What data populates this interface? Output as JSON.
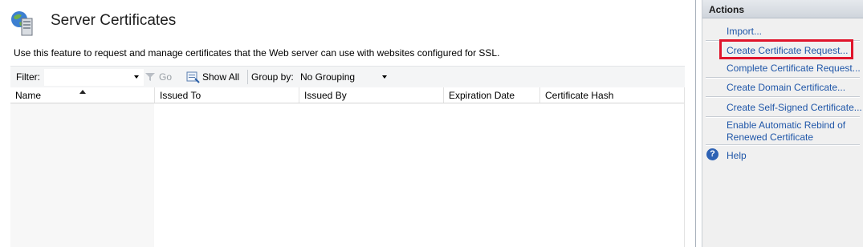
{
  "header": {
    "title": "Server Certificates",
    "description": "Use this feature to request and manage certificates that the Web server can use with websites configured for SSL."
  },
  "toolbar": {
    "filter_label": "Filter:",
    "filter_value": "",
    "go_label": "Go",
    "show_all_label": "Show All",
    "group_by_label": "Group by:",
    "group_by_value": "No Grouping"
  },
  "grid": {
    "columns": [
      "Name",
      "Issued To",
      "Issued By",
      "Expiration Date",
      "Certificate Hash"
    ],
    "sorted_column": "Name",
    "sort_direction": "ascending",
    "rows": []
  },
  "actions": {
    "title": "Actions",
    "items": [
      "Import...",
      "Create Certificate Request...",
      "Complete Certificate Request...",
      "Create Domain Certificate...",
      "Create Self-Signed Certificate...",
      "Enable Automatic Rebind of",
      "Renewed Certificate",
      "Help"
    ],
    "highlighted_item": "Create Certificate Request..."
  },
  "colors": {
    "link": "#1f56a8",
    "highlight": "#e0142b",
    "panel_bg": "#f0f0f0"
  },
  "icons": [
    "server-globe-icon",
    "filter-funnel-icon",
    "show-all-icon",
    "help-icon"
  ]
}
